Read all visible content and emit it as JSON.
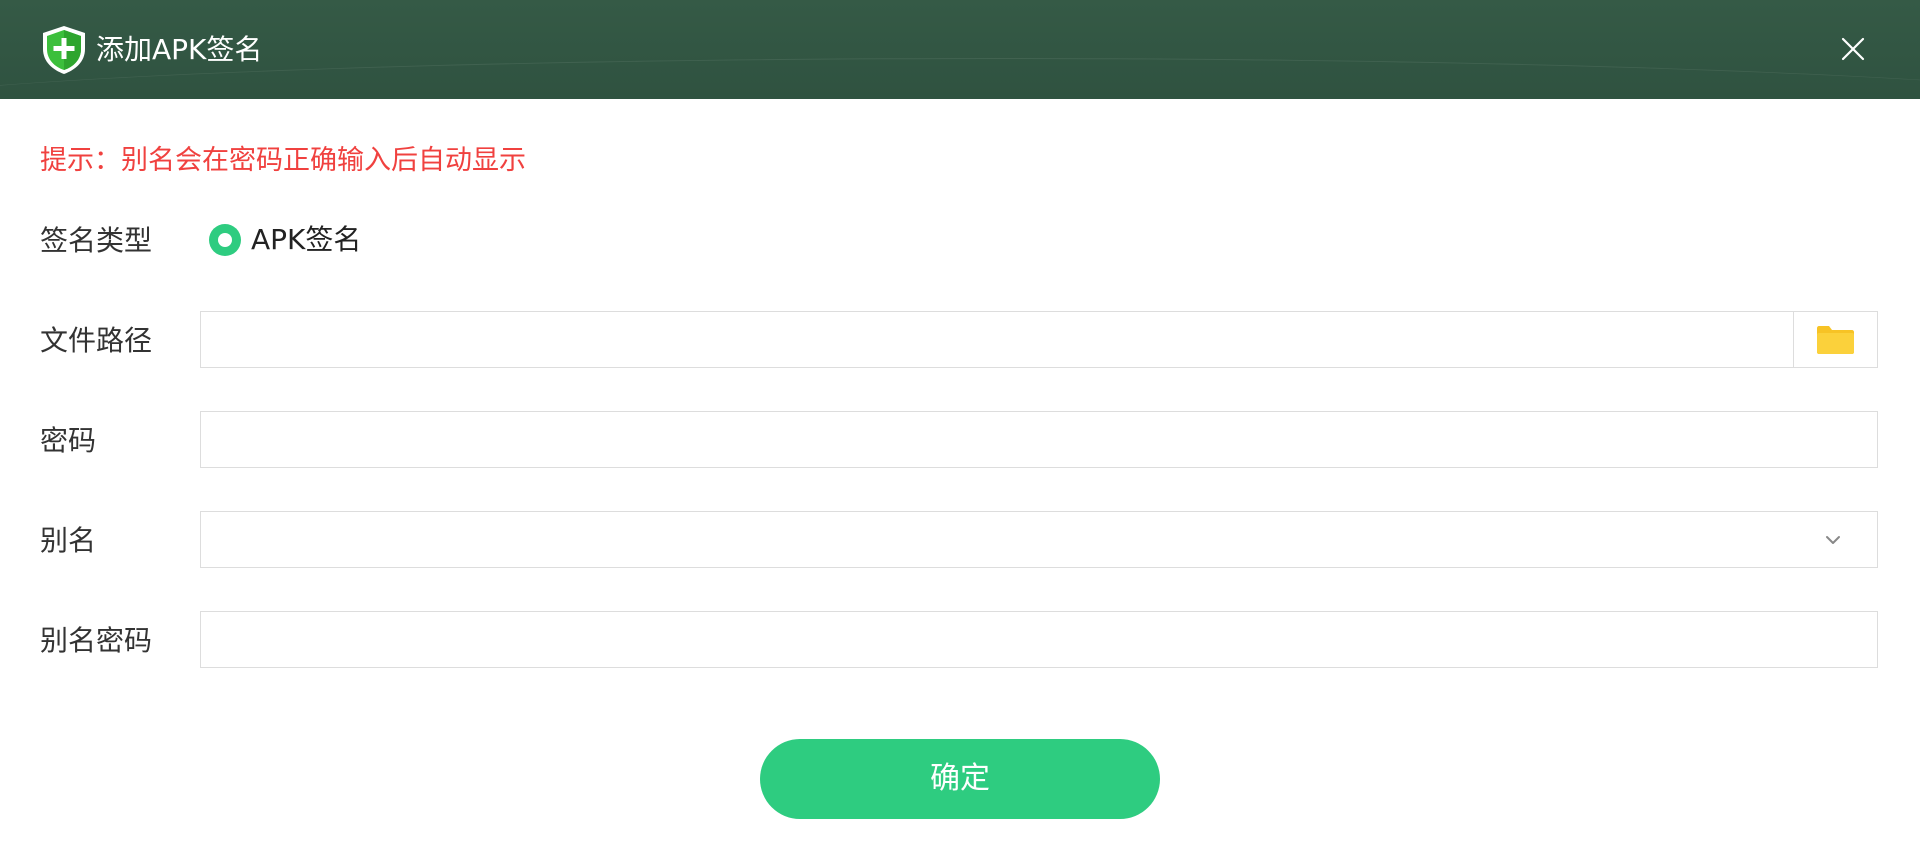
{
  "titlebar": {
    "title": "添加APK签名",
    "icon": "shield-plus-icon",
    "close_icon": "close-icon"
  },
  "hint": "提示：别名会在密码正确输入后自动显示",
  "form": {
    "signature_type": {
      "label": "签名类型",
      "options": [
        "APK签名"
      ],
      "selected": "APK签名"
    },
    "file_path": {
      "label": "文件路径",
      "value": "",
      "browse_icon": "folder-icon"
    },
    "password": {
      "label": "密码",
      "value": ""
    },
    "alias": {
      "label": "别名",
      "value": "",
      "dropdown_icon": "chevron-down-icon"
    },
    "alias_password": {
      "label": "别名密码",
      "value": ""
    }
  },
  "buttons": {
    "confirm": "确定"
  },
  "colors": {
    "titlebar": "#2f5240",
    "accent": "#2ecc80",
    "hint": "#f0413f",
    "folder": "#f7c325"
  }
}
